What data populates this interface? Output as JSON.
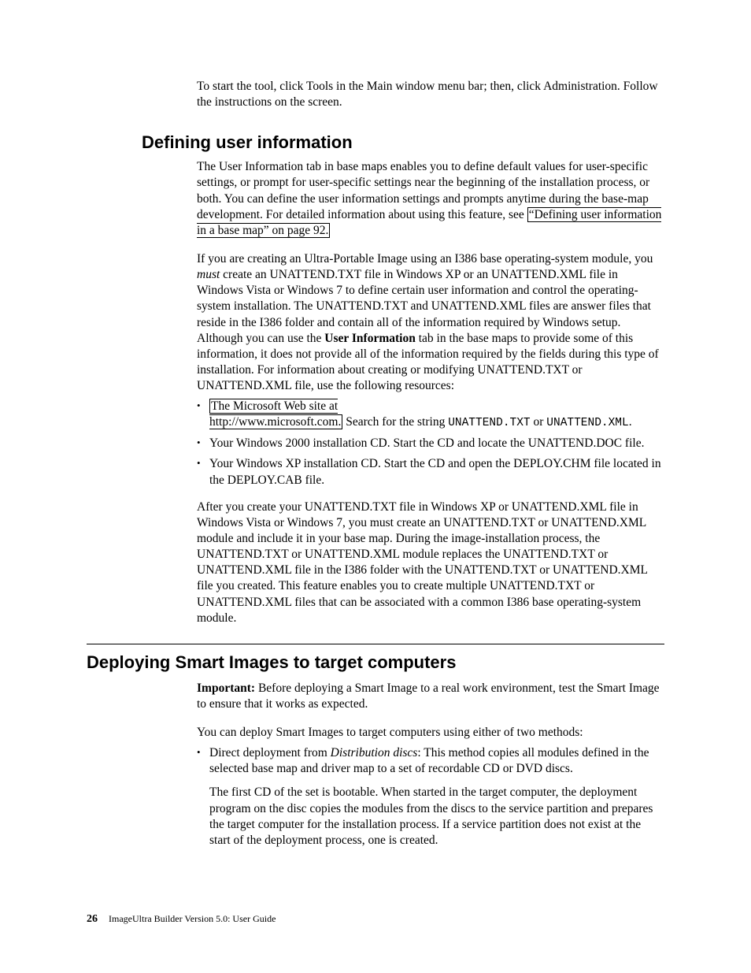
{
  "intro": "To start the tool, click Tools in the Main window menu bar; then, click Administration. Follow the instructions on the screen.",
  "section1": {
    "heading": "Defining user information",
    "para1_pre": "The User Information tab in base maps enables you to define default values for user-specific settings, or prompt for user-specific settings near the beginning of the installation process, or both. You can define the user information settings and prompts anytime during the base-map development. For detailed information about using this feature, see ",
    "para1_xref": "“Defining user information in a base map” on page 92.",
    "para2_a": "If you are creating an Ultra-Portable Image using an I386 base operating-system module, you ",
    "para2_must": "must",
    "para2_b": " create an UNATTEND.TXT file in Windows XP or an UNATTEND.XML file in Windows Vista or Windows 7 to define certain user information and control the operating-system installation. The UNATTEND.TXT and UNATTEND.XML files are answer files that reside in the I386 folder and contain all of the information required by Windows setup. Although you can use the ",
    "para2_bold": "User Information",
    "para2_c": " tab in the base maps to provide some of this information, it does not provide all of the information required by the fields during this type of installation. For information about creating or modifying UNATTEND.TXT or UNATTEND.XML file, use the following resources:",
    "bullet1_a": "The Microsoft Web site at",
    "bullet1_link": "http://www.microsoft.com.",
    "bullet1_b": " Search for the string ",
    "bullet1_mono1": "UNATTEND.TXT",
    "bullet1_c": " or ",
    "bullet1_mono2": "UNATTEND.XML",
    "bullet1_d": ".",
    "bullet2": "Your Windows 2000 installation CD. Start the CD and locate the UNATTEND.DOC file.",
    "bullet3": "Your Windows XP installation CD. Start the CD and open the DEPLOY.CHM file located in the DEPLOY.CAB file.",
    "para3": "After you create your UNATTEND.TXT file in Windows XP or UNATTEND.XML file in Windows Vista or Windows 7, you must create an UNATTEND.TXT or UNATTEND.XML module and include it in your base map. During the image-installation process, the UNATTEND.TXT or UNATTEND.XML module replaces the UNATTEND.TXT or UNATTEND.XML file in the I386 folder with the UNATTEND.TXT or UNATTEND.XML file you created. This feature enables you to create multiple UNATTEND.TXT or UNATTEND.XML files that can be associated with a common I386 base operating-system module."
  },
  "section2": {
    "heading": "Deploying Smart Images to target computers",
    "para1_bold": "Important:",
    "para1": " Before deploying a Smart Image to a real work environment, test the Smart Image to ensure that it works as expected.",
    "para2": "You can deploy Smart Images to target computers using either of two methods:",
    "bullet1_a": "Direct deployment from ",
    "bullet1_italic": "Distribution discs",
    "bullet1_b": ": This method copies all modules defined in the selected base map and driver map to a set of recordable CD or DVD discs.",
    "bullet1_sub": "The first CD of the set is bootable. When started in the target computer, the deployment program on the disc copies the modules from the discs to the service partition and prepares the target computer for the installation process. If a service partition does not exist at the start of the deployment process, one is created."
  },
  "footer": {
    "page": "26",
    "title": "ImageUltra Builder Version 5.0:  User Guide"
  }
}
